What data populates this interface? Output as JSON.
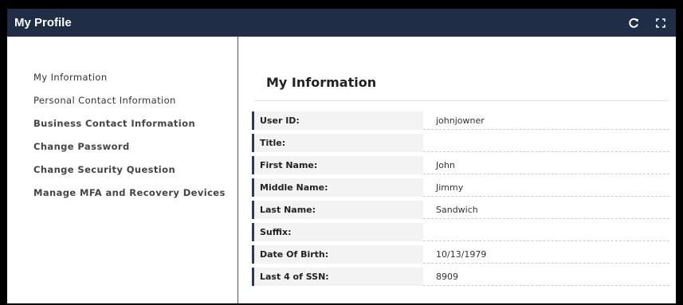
{
  "header": {
    "title": "My Profile"
  },
  "sidebar": {
    "items": [
      {
        "label": "My Information"
      },
      {
        "label": "Personal Contact Information"
      },
      {
        "label": "Business Contact Information"
      },
      {
        "label": "Change Password"
      },
      {
        "label": "Change Security Question"
      },
      {
        "label": "Manage MFA and Recovery Devices"
      }
    ]
  },
  "main": {
    "section_title": "My Information",
    "fields": [
      {
        "label": "User ID:",
        "value": "johnjowner"
      },
      {
        "label": "Title:",
        "value": ""
      },
      {
        "label": "First Name:",
        "value": "John"
      },
      {
        "label": "Middle Name:",
        "value": "Jimmy"
      },
      {
        "label": "Last Name:",
        "value": "Sandwich"
      },
      {
        "label": "Suffix:",
        "value": ""
      },
      {
        "label": "Date Of Birth:",
        "value": "10/13/1979"
      },
      {
        "label": "Last 4 of SSN:",
        "value": "8909"
      }
    ]
  },
  "icons": {
    "refresh": "refresh-icon",
    "expand": "expand-icon"
  },
  "colors": {
    "header_bg": "#1f2d46",
    "label_accent": "#2d3a52",
    "frame": "#000000"
  }
}
